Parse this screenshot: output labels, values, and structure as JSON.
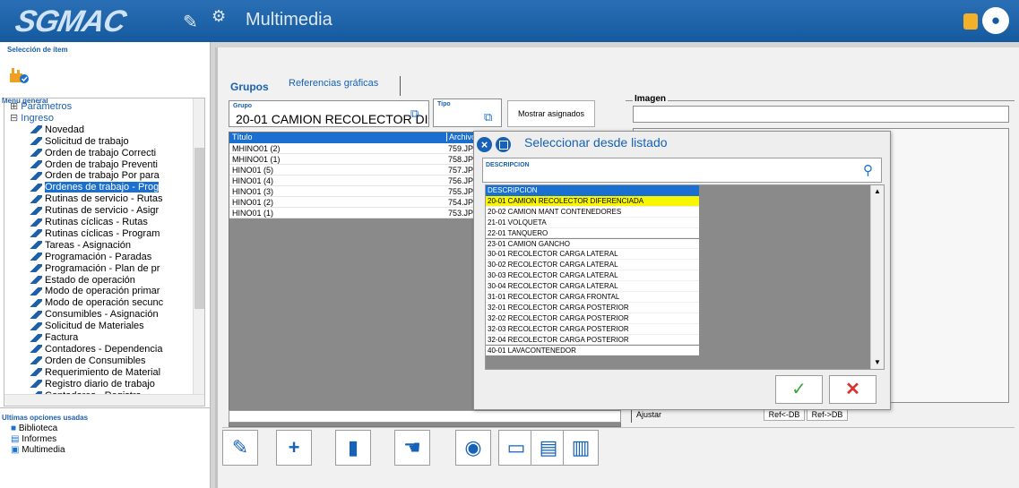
{
  "app": {
    "logo": "SGMAC",
    "title": "Multimedia",
    "colors": {
      "brand": "#155a9e",
      "accent": "#1a6fd0",
      "highlight": "#f7f500"
    }
  },
  "icons": {
    "pin": "pin-icon",
    "multimedia": "multimedia-icon",
    "lock": "lock-icon",
    "user": "user-icon"
  },
  "left": {
    "item_section": "Selección de ítem",
    "menu_section": "Menú general",
    "tree": [
      {
        "label": "Parámetros",
        "level": 0
      },
      {
        "label": "Ingreso",
        "level": 0
      },
      {
        "label": "Novedad",
        "level": 1
      },
      {
        "label": "Solicitud de trabajo",
        "level": 1
      },
      {
        "label": "Orden de trabajo Correcti",
        "level": 1
      },
      {
        "label": "Orden de trabajo Preventi",
        "level": 1
      },
      {
        "label": "Orden de trabajo Por para",
        "level": 1
      },
      {
        "label": "Ordenes de trabajo - Prog",
        "level": 1,
        "selected": true
      },
      {
        "label": "Rutinas de servicio - Rutas",
        "level": 1
      },
      {
        "label": "Rutinas de servicio - Asigr",
        "level": 1
      },
      {
        "label": "Rutinas cíclicas - Rutas",
        "level": 1
      },
      {
        "label": "Rutinas cíclicas - Program",
        "level": 1
      },
      {
        "label": "Tareas - Asignación",
        "level": 1
      },
      {
        "label": "Programación - Paradas",
        "level": 1
      },
      {
        "label": "Programación - Plan de pr",
        "level": 1
      },
      {
        "label": "Estado de operación",
        "level": 1
      },
      {
        "label": "Modo de operación primar",
        "level": 1
      },
      {
        "label": "Modo de operación secunc",
        "level": 1
      },
      {
        "label": "Consumibles - Asignación",
        "level": 1
      },
      {
        "label": "Solicitud de Materiales",
        "level": 1
      },
      {
        "label": "Factura",
        "level": 1
      },
      {
        "label": "Contadores - Dependencia",
        "level": 1
      },
      {
        "label": "Orden de Consumibles",
        "level": 1
      },
      {
        "label": "Requerimiento de Material",
        "level": 1
      },
      {
        "label": "Registro diario de trabajo",
        "level": 1
      },
      {
        "label": "Contadores - Registro",
        "level": 1
      }
    ],
    "last_section": "Ultimas opciones usadas",
    "last": [
      "Biblioteca",
      "Informes",
      "Multimedia"
    ]
  },
  "main": {
    "tabs": [
      "Grupos",
      "Referencias gráficas"
    ],
    "grupo_label": "Grupo",
    "grupo_value": "20-01 CAMION RECOLECTOR DI",
    "tipo_label": "Tipo",
    "tipo_value": "",
    "mostrar_button": "Mostrar asignados",
    "imagen_label": "Imagen",
    "columns": [
      "Título",
      "Archivo"
    ],
    "rows": [
      [
        "MHINO01 (2)",
        "759.JP"
      ],
      [
        "MHINO01 (1)",
        "758.JP"
      ],
      [
        "HINO01 (5)",
        "757.JP"
      ],
      [
        "HINO01 (4)",
        "756.JP"
      ],
      [
        "HINO01 (3)",
        "755.JP"
      ],
      [
        "HINO01 (2)",
        "754.JP"
      ],
      [
        "HINO01 (1)",
        "753.JP"
      ]
    ],
    "ajustar": "Ajustar",
    "ref_db_left": "Ref<-DB",
    "ref_db_right": "Ref->DB"
  },
  "toolbar": {
    "edit": "pencil-icon",
    "add": "plus-icon",
    "delete": "trash-icon",
    "hand": "hand-icon",
    "view": "eye-icon",
    "note": "note-icon",
    "file": "file-icon",
    "print": "printer-icon"
  },
  "dialog": {
    "title": "Seleccionar desde listado",
    "search_label": "DESCRIPCION",
    "header": "DESCRIPCION",
    "items": [
      "20-01 CAMION RECOLECTOR DIFERENCIADA",
      "20-02 CAMION MANT CONTENEDORES",
      "21-01 VOLQUETA",
      "22-01 TANQUERO",
      "23-01 CAMION GANCHO",
      "30-01 RECOLECTOR CARGA LATERAL",
      "30-02 RECOLECTOR CARGA LATERAL",
      "30-03 RECOLECTOR CARGA LATERAL",
      "30-04 RECOLECTOR CARGA LATERAL",
      "31-01 RECOLECTOR CARGA FRONTAL",
      "32-01 RECOLECTOR CARGA POSTERIOR",
      "32-02 RECOLECTOR CARGA POSTERIOR",
      "32-03 RECOLECTOR CARGA POSTERIOR",
      "32-04 RECOLECTOR CARGA POSTERIOR",
      "40-01 LAVACONTENEDOR"
    ],
    "highlighted": 0
  }
}
